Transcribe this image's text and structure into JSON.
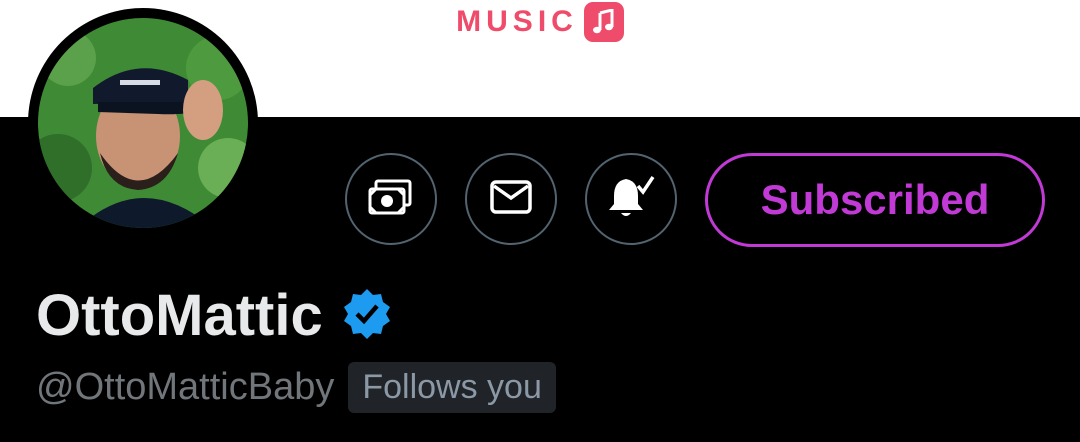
{
  "header": {
    "brand_text": "MUSIC",
    "brand_color": "#ef4b6b",
    "brand_icon": "music-note-icon"
  },
  "profile": {
    "display_name": "OttoMattic",
    "handle": "@OttoMatticBaby",
    "follows_badge": "Follows you",
    "verified_icon": "verified-badge-icon",
    "verified_color": "#1d9bf0"
  },
  "actions": {
    "tip_icon": "money-icon",
    "message_icon": "mail-icon",
    "notify_icon": "bell-check-icon",
    "subscribe_label": "Subscribed",
    "subscribe_color": "#c13ad6"
  }
}
